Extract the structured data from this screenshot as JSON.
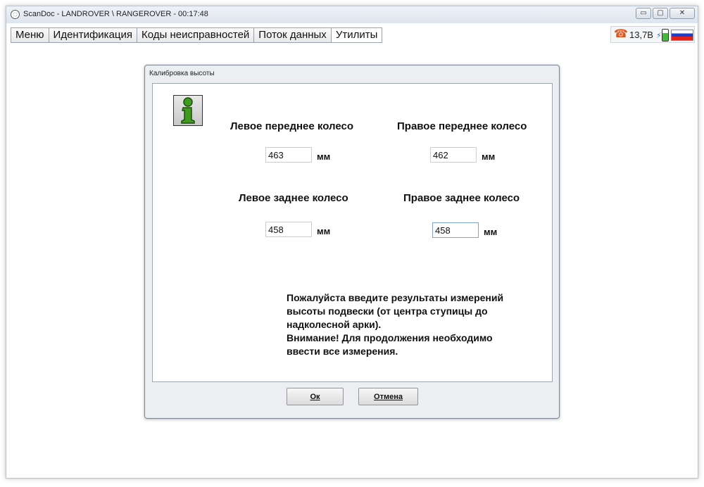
{
  "window": {
    "title": "ScanDoc - LANDROVER \\ RANGEROVER - 00:17:48",
    "controls": {
      "minimize": "▭",
      "maximize": "▢",
      "close": "✕"
    }
  },
  "menu": {
    "tabs": [
      {
        "label": "Меню"
      },
      {
        "label": "Идентификация"
      },
      {
        "label": "Коды неисправностей"
      },
      {
        "label": "Поток данных"
      },
      {
        "label": "Утилиты"
      }
    ],
    "active_tab": "Утилиты"
  },
  "status": {
    "voltage": "13,7В",
    "phone_icon": "☎",
    "plug_icon": "⚡",
    "colors": {
      "phone": "#e0561b",
      "battery_fill": "#46b83b"
    }
  },
  "dialog": {
    "title": "Калибровка высоты",
    "front_left": {
      "label": "Левое переднее колесо",
      "value": "463",
      "unit": "мм"
    },
    "front_right": {
      "label": "Правое переднее колесо",
      "value": "462",
      "unit": "мм"
    },
    "rear_left": {
      "label": "Левое заднее колесо",
      "value": "458",
      "unit": "мм"
    },
    "rear_right": {
      "label": "Правое заднее колесо",
      "value": "458",
      "unit": "мм"
    },
    "message_lines": [
      "Пожалуйста введите результаты измерений",
      "высоты подвески (от центра ступицы до",
      "надколесной арки).",
      "Внимание! Для продолжения необходимо",
      "ввести все измерения."
    ],
    "ok_label": "Ок",
    "cancel_label": "Отмена",
    "info_icon_color": "#3f9a1e"
  }
}
